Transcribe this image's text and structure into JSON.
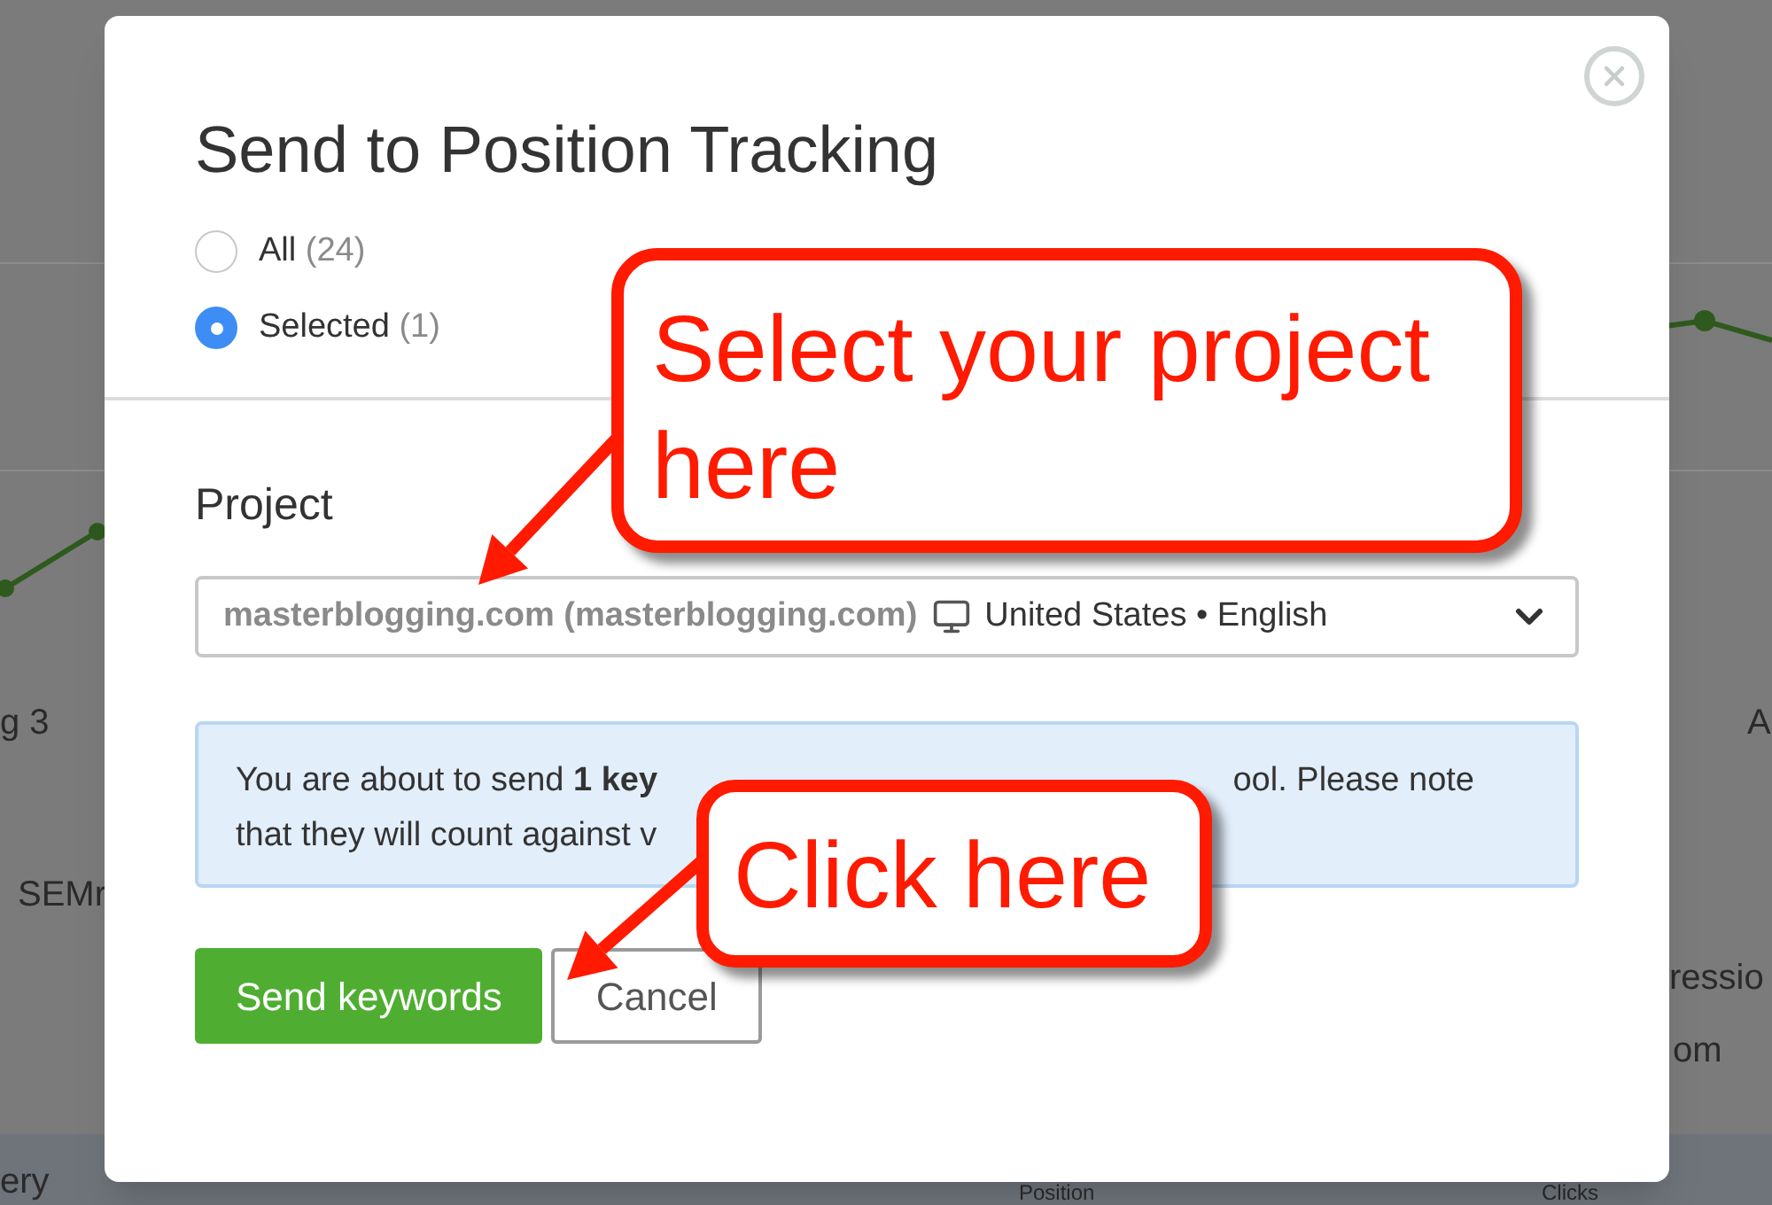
{
  "background": {
    "fragments": [
      {
        "text": "g 3"
      },
      {
        "text": "A"
      },
      {
        "text": "SEMr"
      },
      {
        "text": "ressio"
      },
      {
        "text": "om"
      },
      {
        "text": "ery"
      },
      {
        "text": "Position"
      },
      {
        "text": "Clicks"
      }
    ]
  },
  "dialog": {
    "title": "Send to Position Tracking",
    "scope_options": [
      {
        "label": "All",
        "count": "(24)",
        "selected": false
      },
      {
        "label": "Selected",
        "count": "(1)",
        "selected": true
      }
    ],
    "project": {
      "label": "Project",
      "value": "masterblogging.com (masterblogging.com)",
      "location": "United States • English"
    },
    "notice": {
      "line_1_start": "You are about to send **1 key**",
      "line_1_end": "ool. Please note",
      "line_2": "that they will count against v"
    },
    "buttons": [
      {
        "label": "Send keywords",
        "kind": "primary"
      },
      {
        "label": "Cancel",
        "kind": "secondary"
      }
    ]
  },
  "callouts": [
    {
      "text": "Select your project here"
    },
    {
      "text": "Click here"
    }
  ]
}
